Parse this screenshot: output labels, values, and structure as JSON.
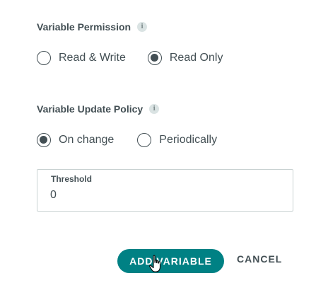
{
  "permission": {
    "title": "Variable Permission",
    "info_glyph": "i",
    "options": [
      {
        "label": "Read & Write",
        "checked": false
      },
      {
        "label": "Read Only",
        "checked": true
      }
    ]
  },
  "update_policy": {
    "title": "Variable Update Policy",
    "info_glyph": "i",
    "options": [
      {
        "label": "On change",
        "checked": true
      },
      {
        "label": "Periodically",
        "checked": false
      }
    ]
  },
  "threshold": {
    "label": "Threshold",
    "value": "0"
  },
  "actions": {
    "add_label": "ADD VARIABLE",
    "cancel_label": "CANCEL"
  },
  "colors": {
    "primary": "#008184",
    "text": "#434f54",
    "border": "#c9d2d2"
  },
  "icons": {
    "info": "info-icon",
    "cursor": "hand-pointer-cursor-icon"
  }
}
